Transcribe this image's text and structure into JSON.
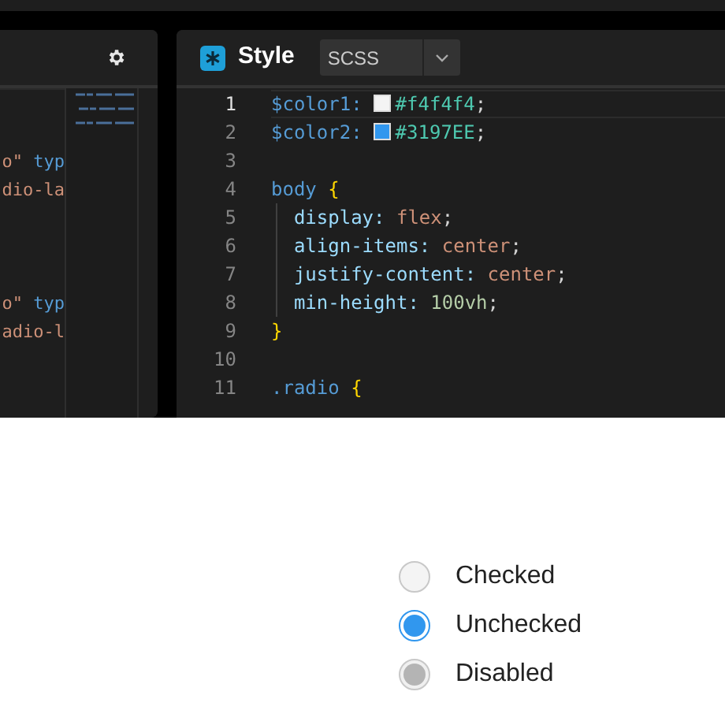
{
  "left_panel": {
    "code_lines": [
      {
        "kind": "blank"
      },
      {
        "kind": "blank"
      },
      {
        "kind": "code",
        "tokens": [
          {
            "text": "o\"",
            "kind": "string"
          },
          {
            "text": " typ",
            "kind": "attr"
          }
        ]
      },
      {
        "kind": "code",
        "tokens": [
          {
            "text": "dio-la",
            "kind": "string"
          }
        ]
      },
      {
        "kind": "blank"
      },
      {
        "kind": "blank"
      },
      {
        "kind": "blank"
      },
      {
        "kind": "code",
        "tokens": [
          {
            "text": "o\"",
            "kind": "string"
          },
          {
            "text": " typ",
            "kind": "attr"
          }
        ]
      },
      {
        "kind": "code",
        "tokens": [
          {
            "text": "adio-l",
            "kind": "string"
          }
        ]
      }
    ]
  },
  "style_panel": {
    "title": "Style",
    "language": "SCSS",
    "lines": [
      {
        "number": "1",
        "current": true,
        "guide": false,
        "tokens": [
          {
            "text": "$color1:",
            "kind": "variable"
          },
          {
            "kind": "swatch",
            "color": "#f4f4f4"
          },
          {
            "text": "#f4f4f4",
            "kind": "hex"
          },
          {
            "text": ";",
            "kind": "plain"
          }
        ]
      },
      {
        "number": "2",
        "current": false,
        "guide": false,
        "tokens": [
          {
            "text": "$color2:",
            "kind": "variable"
          },
          {
            "kind": "swatch",
            "color": "#3197ee"
          },
          {
            "text": "#3197EE",
            "kind": "hex"
          },
          {
            "text": ";",
            "kind": "plain"
          }
        ]
      },
      {
        "number": "3",
        "current": false,
        "guide": false
      },
      {
        "number": "4",
        "current": false,
        "guide": false,
        "tokens": [
          {
            "text": "body",
            "kind": "selector"
          },
          {
            "text": " {",
            "kind": "brace"
          }
        ]
      },
      {
        "number": "5",
        "current": false,
        "guide": true,
        "tokens": [
          {
            "text": "  display:",
            "kind": "property"
          },
          {
            "text": " flex",
            "kind": "value"
          },
          {
            "text": ";",
            "kind": "plain"
          }
        ]
      },
      {
        "number": "6",
        "current": false,
        "guide": true,
        "tokens": [
          {
            "text": "  align-items:",
            "kind": "property"
          },
          {
            "text": " center",
            "kind": "value"
          },
          {
            "text": ";",
            "kind": "plain"
          }
        ]
      },
      {
        "number": "7",
        "current": false,
        "guide": true,
        "tokens": [
          {
            "text": "  justify-content:",
            "kind": "property"
          },
          {
            "text": " center",
            "kind": "value"
          },
          {
            "text": ";",
            "kind": "plain"
          }
        ]
      },
      {
        "number": "8",
        "current": false,
        "guide": true,
        "tokens": [
          {
            "text": "  min-height:",
            "kind": "property"
          },
          {
            "text": " 100vh",
            "kind": "number"
          },
          {
            "text": ";",
            "kind": "plain"
          }
        ]
      },
      {
        "number": "9",
        "current": false,
        "guide": false,
        "tokens": [
          {
            "text": "}",
            "kind": "brace"
          }
        ]
      },
      {
        "number": "10",
        "current": false,
        "guide": false
      },
      {
        "number": "11",
        "current": false,
        "guide": false,
        "tokens": [
          {
            "text": ".radio",
            "kind": "selector"
          },
          {
            "text": " {",
            "kind": "brace"
          }
        ]
      }
    ]
  },
  "preview": {
    "radios": [
      {
        "label": "Checked",
        "selected": false,
        "disabled": false
      },
      {
        "label": "Unchecked",
        "selected": true,
        "disabled": false
      },
      {
        "label": "Disabled",
        "selected": false,
        "disabled": true
      }
    ]
  }
}
